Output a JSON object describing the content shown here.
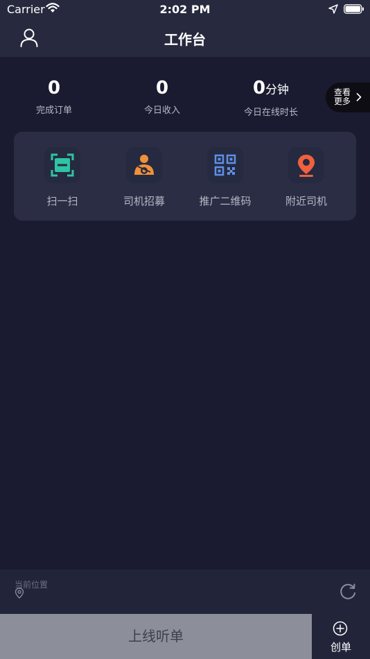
{
  "status_bar": {
    "carrier": "Carrier",
    "time": "2:02 PM"
  },
  "nav": {
    "title": "工作台",
    "user_icon": "user-icon"
  },
  "stats": [
    {
      "value": "0",
      "unit": "",
      "label": "完成订单"
    },
    {
      "value": "0",
      "unit": "",
      "label": "今日收入"
    },
    {
      "value": "0",
      "unit": "分钟",
      "label": "今日在线时长"
    }
  ],
  "more": {
    "line1": "查看",
    "line2": "更多",
    "icon": "chevron-right-icon"
  },
  "tools": [
    {
      "label": "扫一扫",
      "icon": "scan-icon",
      "color": "#2fc4a3"
    },
    {
      "label": "司机招募",
      "icon": "driver-recruit-icon",
      "color": "#f0913a"
    },
    {
      "label": "推广二维码",
      "icon": "qr-code-icon",
      "color": "#5f8fe8"
    },
    {
      "label": "附近司机",
      "icon": "location-pin-icon",
      "color": "#f0603e"
    }
  ],
  "location": {
    "label": "当前位置",
    "icon": "map-pin-icon",
    "refresh_icon": "refresh-icon"
  },
  "bottom": {
    "online_label": "上线听单",
    "create_label": "创单",
    "create_icon": "plus-circle-icon"
  },
  "colors": {
    "background": "#1a1b30",
    "header": "#272a3e",
    "card": "#2a2d44",
    "online_button": "#8c8f9a"
  }
}
